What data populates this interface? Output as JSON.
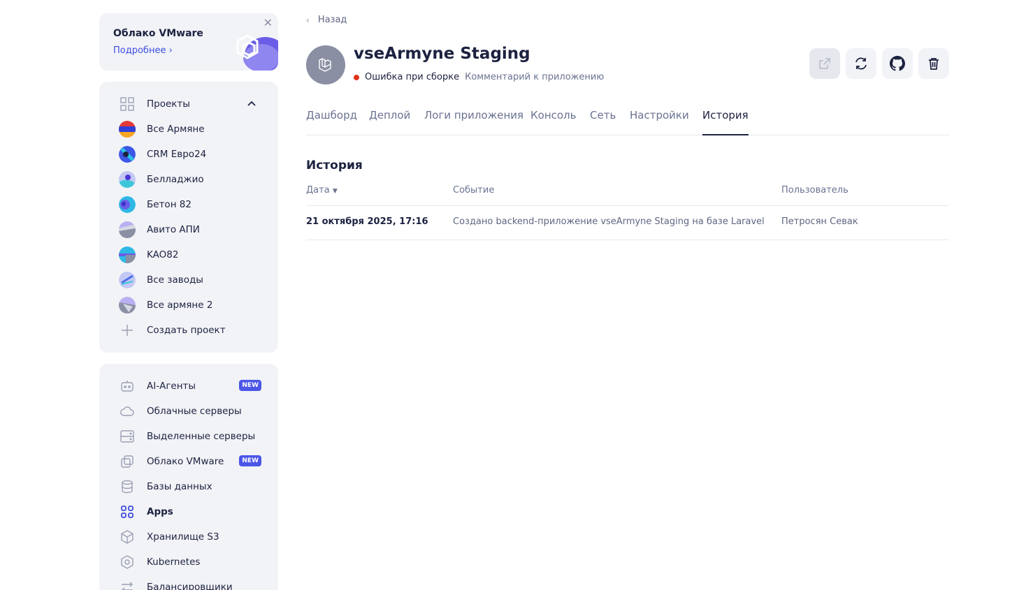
{
  "promo": {
    "title": "Облако VMware",
    "link_label": "Подробнее",
    "close_icon": "close-icon"
  },
  "projects": {
    "header_label": "Проекты",
    "items": [
      {
        "label": "Все Армяне"
      },
      {
        "label": "CRM Евро24"
      },
      {
        "label": "Белладжио"
      },
      {
        "label": "Бетон 82"
      },
      {
        "label": "Авито АПИ"
      },
      {
        "label": "KAO82"
      },
      {
        "label": "Все заводы"
      },
      {
        "label": "Все армяне 2"
      }
    ],
    "create_label": "Создать проект"
  },
  "services": {
    "items": [
      {
        "label": "AI-Агенты",
        "icon": "robot-icon",
        "badge": "NEW"
      },
      {
        "label": "Облачные серверы",
        "icon": "cloud-icon"
      },
      {
        "label": "Выделенные серверы",
        "icon": "server-icon"
      },
      {
        "label": "Облако VMware",
        "icon": "vmware-icon",
        "badge": "NEW"
      },
      {
        "label": "Базы данных",
        "icon": "database-icon"
      },
      {
        "label": "Apps",
        "icon": "apps-icon",
        "active": true
      },
      {
        "label": "Хранилище S3",
        "icon": "cube-icon"
      },
      {
        "label": "Kubernetes",
        "icon": "kubernetes-icon"
      },
      {
        "label": "Балансировщики",
        "icon": "balancer-icon"
      }
    ]
  },
  "header": {
    "back_label": "Назад",
    "app_name": "vseArmyne Staging",
    "status": "Ошибка при сборке",
    "status_color": "#e0341c",
    "comment_label": "Комментарий к приложению"
  },
  "tabs": [
    {
      "label": "Дашборд"
    },
    {
      "label": "Деплой"
    },
    {
      "label": "Логи приложения"
    },
    {
      "label": "Консоль"
    },
    {
      "label": "Сеть"
    },
    {
      "label": "Настройки"
    },
    {
      "label": "История",
      "active": true
    }
  ],
  "history": {
    "title": "История",
    "columns": {
      "date": "Дата",
      "event": "Событие",
      "user": "Пользователь"
    },
    "rows": [
      {
        "date": "21 октября 2025, 17:16",
        "event": "Создано backend-приложение vseArmyne Staging на базе Laravel",
        "user": "Петросян Севак"
      }
    ]
  },
  "colors": {
    "accent": "#4b56e8",
    "text": "#1c2240",
    "muted": "#6a7291",
    "panel": "#f2f3f7"
  }
}
